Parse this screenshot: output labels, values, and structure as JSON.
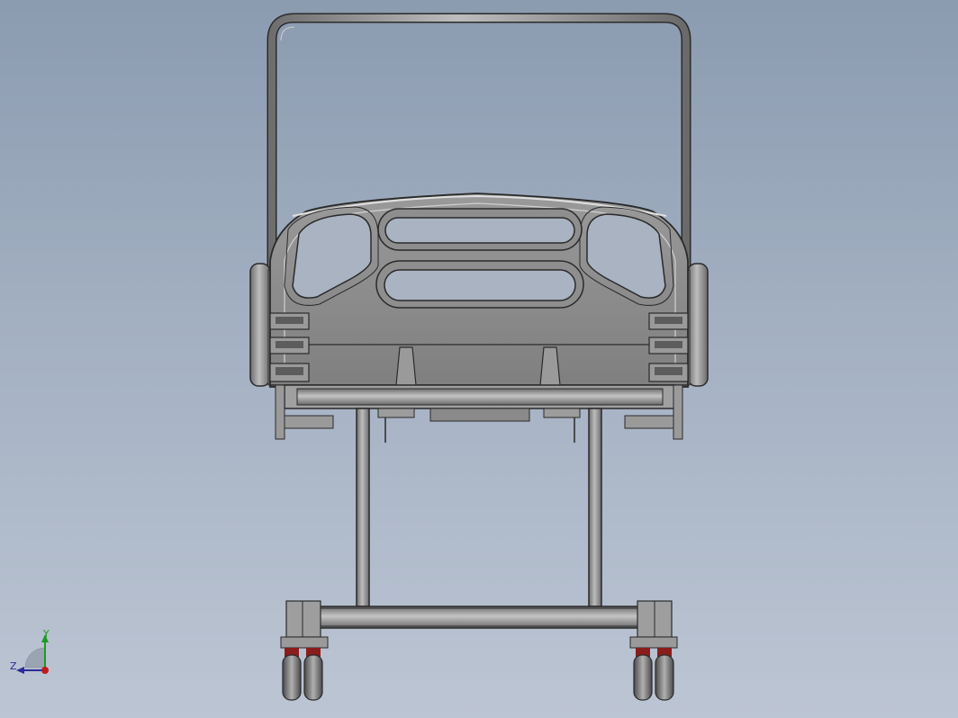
{
  "viewport": {
    "background_top": "#8b9bb0",
    "background_bottom": "#bcc5d3"
  },
  "model": {
    "body_color": "#8e8e8e",
    "edge_color": "#2a2a2a",
    "highlight_color": "#d8d8d8",
    "wheel_accent_color": "#8a1c1c"
  },
  "triad": {
    "y_label": "Y",
    "z_label": "Z",
    "y_color": "#1f9a1f",
    "z_color": "#2b2b9a",
    "origin_color": "#c21a1a"
  }
}
